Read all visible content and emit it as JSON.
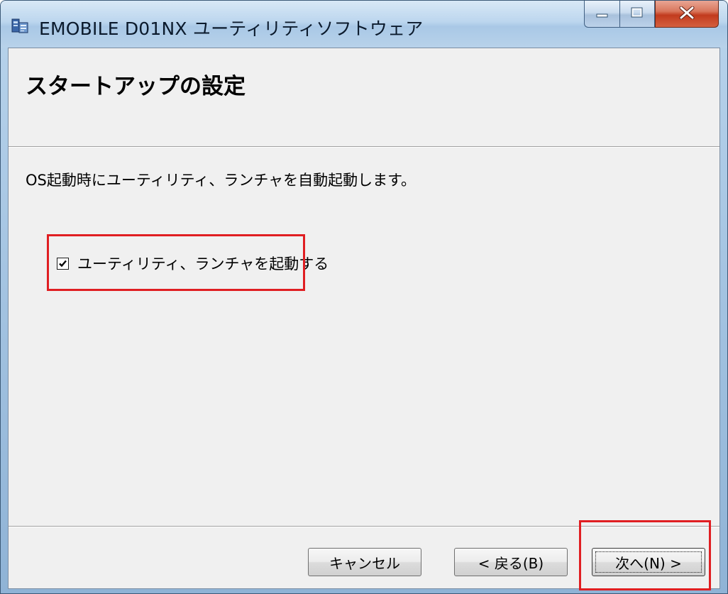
{
  "window": {
    "title": "EMOBILE D01NX ユーティリティソフトウェア"
  },
  "caption_buttons": {
    "minimize_icon": "minimize-icon",
    "maximize_icon": "maximize-icon",
    "close_icon": "close-icon"
  },
  "header": {
    "title": "スタートアップの設定"
  },
  "main": {
    "description": "OS起動時にユーティリティ、ランチャを自動起動します。",
    "checkbox": {
      "label": "ユーティリティ、ランチャを起動する",
      "checked": true
    }
  },
  "footer": {
    "cancel_label": "キャンセル",
    "back_label": "< 戻る(B)",
    "next_label": "次へ(N) >"
  },
  "colors": {
    "highlight": "#e01e22",
    "close_button": "#c23b1e",
    "dialog_background": "#f0f0f0"
  }
}
